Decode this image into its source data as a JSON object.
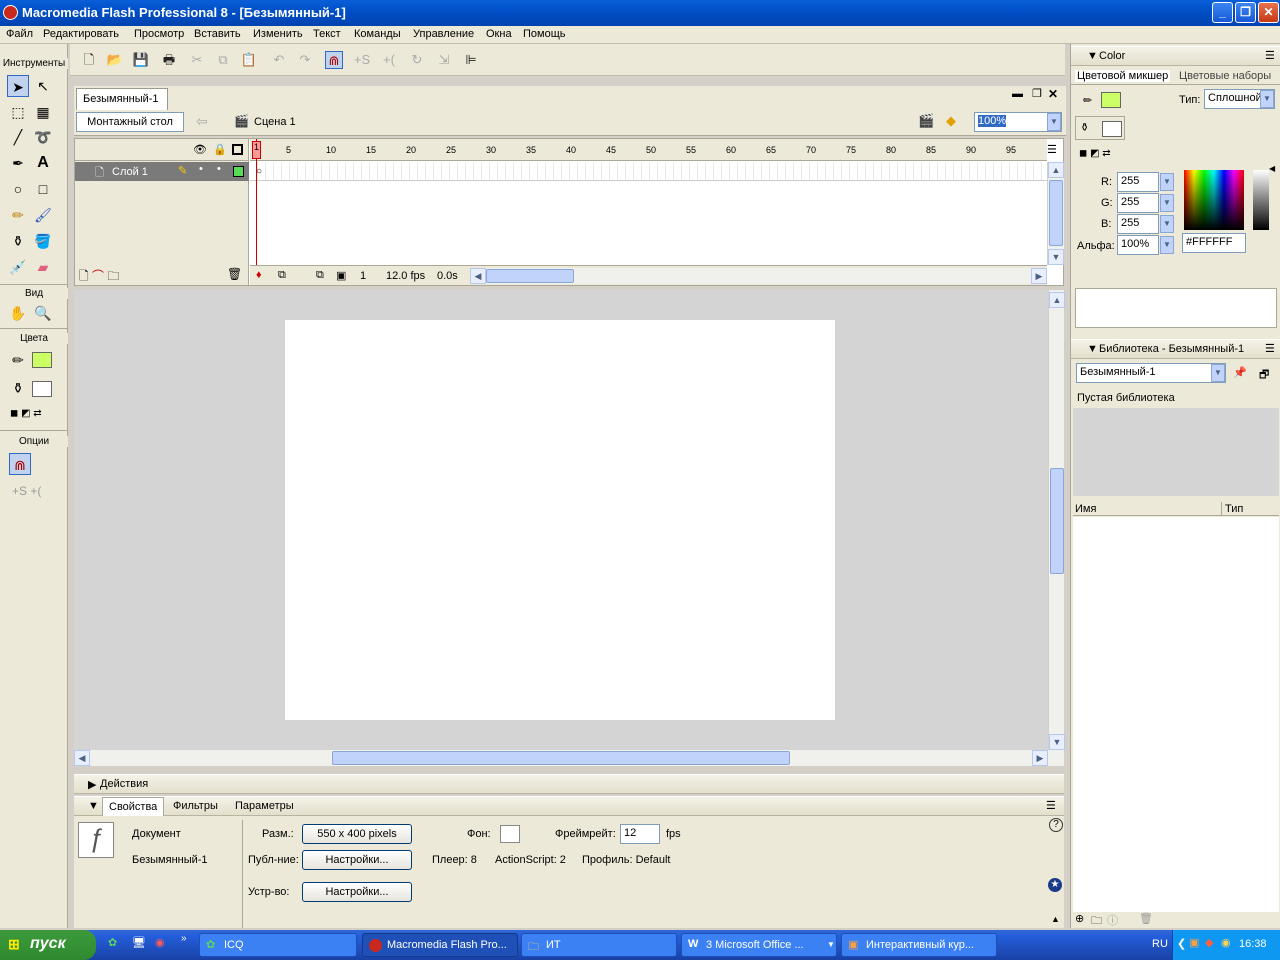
{
  "window": {
    "title": "Macromedia Flash Professional 8 - [Безымянный-1]"
  },
  "menu": [
    "Файл",
    "Редактировать",
    "Просмотр",
    "Вставить",
    "Изменить",
    "Текст",
    "Команды",
    "Управление",
    "Окна",
    "Помощь"
  ],
  "toolbox": {
    "title": "Инструменты",
    "view_label": "Вид",
    "colors_label": "Цвета",
    "options_label": "Опции"
  },
  "document": {
    "tab": "Безымянный-1",
    "timeline_button": "Монтажный стол",
    "scene": "Сцена 1",
    "zoom": "100%"
  },
  "timeline": {
    "layer": "Слой 1",
    "frame_numbers": [
      "1",
      "5",
      "10",
      "15",
      "20",
      "25",
      "30",
      "35",
      "40",
      "45",
      "50",
      "55",
      "60",
      "65",
      "70",
      "75",
      "80",
      "85",
      "90",
      "95"
    ],
    "current_frame": "1",
    "fps": "12.0 fps",
    "time": "0.0s"
  },
  "panels": {
    "actions": "Действия",
    "tabs": [
      "Свойства",
      "Фильтры",
      "Параметры"
    ]
  },
  "props": {
    "doc_label": "Документ",
    "doc_name": "Безымянный-1",
    "size_label": "Разм.:",
    "size_value": "550 x 400 pixels",
    "publish_label": "Публ-ние:",
    "settings_btn": "Настройки...",
    "device_label": "Устр-во:",
    "device_btn": "Настройки...",
    "bg_label": "Фон:",
    "fps_label": "Фреймрейт:",
    "fps_value": "12",
    "fps_unit": "fps",
    "player": "Плеер: 8",
    "actionscript": "ActionScript: 2",
    "profile": "Профиль: Default"
  },
  "color": {
    "title": "Color",
    "tab_mixer": "Цветовой микшер",
    "tab_swatches": "Цветовые наборы",
    "type_label": "Тип:",
    "type_value": "Сплошной",
    "r_label": "R:",
    "r": "255",
    "g_label": "G:",
    "g": "255",
    "b_label": "B:",
    "b": "255",
    "alpha_label": "Альфа:",
    "alpha": "100%",
    "hex": "#FFFFFF",
    "fill_color": "#ccff66"
  },
  "library": {
    "title": "Библиотека - Безымянный-1",
    "doc": "Безымянный-1",
    "empty": "Пустая библиотека",
    "col_name": "Имя",
    "col_type": "Тип"
  },
  "taskbar": {
    "start": "пуск",
    "tasks": [
      "ICQ",
      "Macromedia Flash Pro...",
      "ИТ",
      "3 Microsoft Office ...",
      "Интерактивный кур..."
    ],
    "lang": "RU",
    "clock": "16:38"
  }
}
